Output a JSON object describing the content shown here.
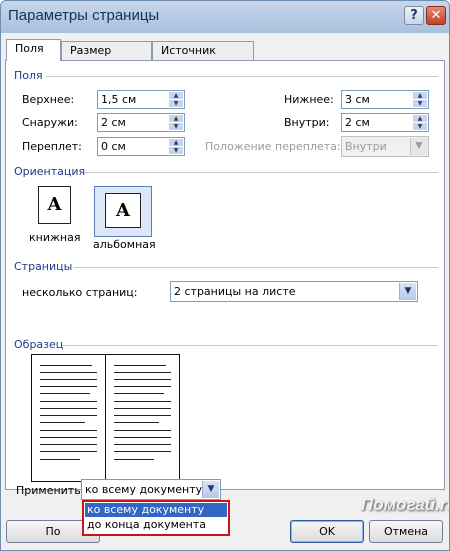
{
  "window": {
    "title": "Параметры страницы",
    "help_glyph": "?",
    "close_glyph": "✕"
  },
  "tabs": [
    {
      "label": "Поля",
      "active": true
    },
    {
      "label": "Размер бумаги",
      "active": false
    },
    {
      "label": "Источник бумаги",
      "active": false
    }
  ],
  "margins": {
    "section_label": "Поля",
    "top": {
      "label": "Верхнее:",
      "value": "1,5 см"
    },
    "bottom": {
      "label": "Нижнее:",
      "value": "3 см"
    },
    "outside": {
      "label": "Снаружи:",
      "value": "2 см"
    },
    "inside": {
      "label": "Внутри:",
      "value": "2 см"
    },
    "gutter": {
      "label": "Переплет:",
      "value": "0 см"
    },
    "gutter_position": {
      "label": "Положение переплета:",
      "value": "Внутри",
      "disabled": true
    }
  },
  "orientation": {
    "section_label": "Ориентация",
    "portrait": {
      "label": "книжная",
      "glyph": "A"
    },
    "landscape": {
      "label": "альбомная",
      "glyph": "A",
      "selected": true
    }
  },
  "pages": {
    "section_label": "Страницы",
    "multiple_label": "несколько страниц:",
    "multiple_value": "2 страницы на листе"
  },
  "preview": {
    "section_label": "Образец"
  },
  "apply": {
    "label": "Применить:",
    "value": "ко всему документу",
    "options": [
      "ко всему документу",
      "до конца документа"
    ],
    "selected_index": 0
  },
  "buttons": {
    "default": "По умолчанию...",
    "ok": "OK",
    "cancel": "Отмена"
  },
  "watermark": "Помогай.ru",
  "colors": {
    "section_label": "#1e3a8a",
    "highlight": "#3166c4",
    "annotation_box": "#c8141a"
  }
}
